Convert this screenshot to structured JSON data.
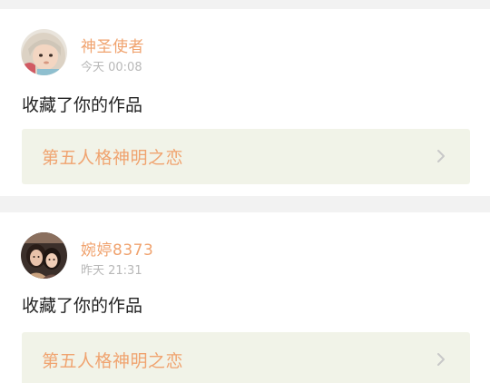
{
  "feed": {
    "items": [
      {
        "username": "神圣使者",
        "time": "今天 00:08",
        "action": "收藏了你的作品",
        "work_title": "第五人格神明之恋",
        "avatar_icon": "baby-photo-avatar"
      },
      {
        "username": "婉婷8373",
        "time": "昨天 21:31",
        "action": "收藏了你的作品",
        "work_title": "第五人格神明之恋",
        "avatar_icon": "two-girls-photo-avatar"
      }
    ]
  },
  "colors": {
    "accent": "#f0a36f",
    "link_bg": "#f1f3e8",
    "time": "#b8b8b8",
    "page_bg": "#f2f2f2"
  }
}
